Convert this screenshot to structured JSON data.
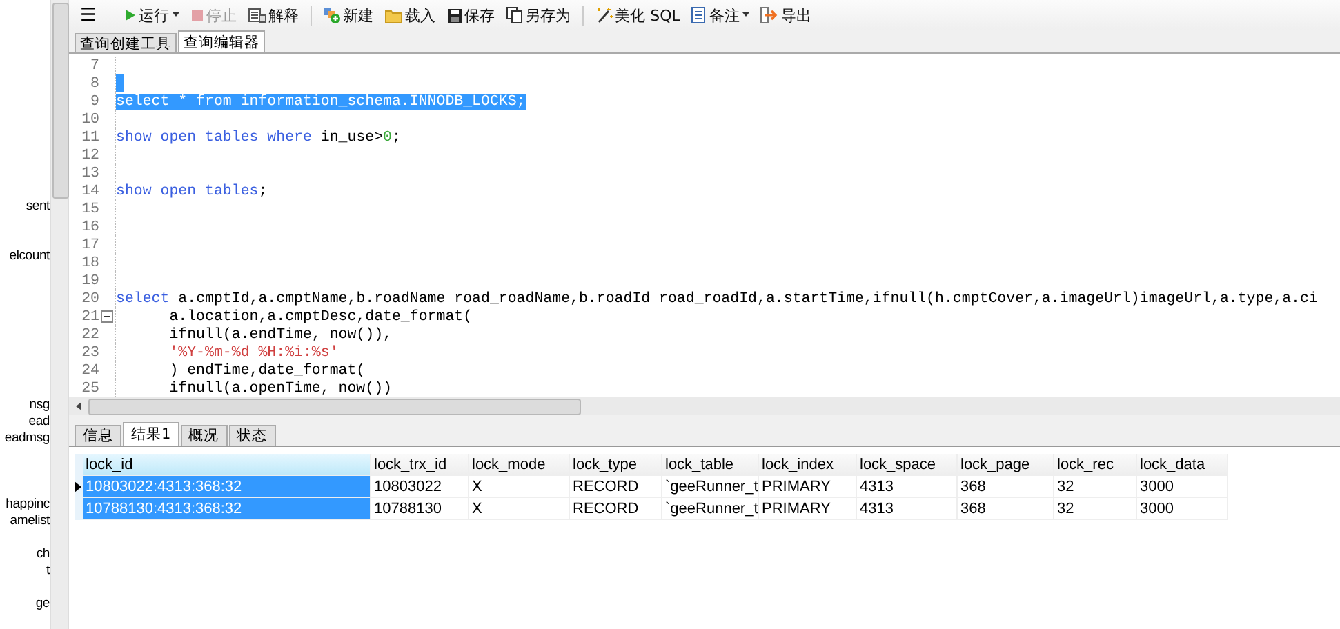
{
  "sidebar": {
    "items": [
      {
        "text": "sent"
      },
      {
        "text": "elcount"
      },
      {
        "text": "nsg"
      },
      {
        "text": "ead"
      },
      {
        "text": "eadmsg"
      },
      {
        "text": "happinc"
      },
      {
        "text": "amelist"
      },
      {
        "text": "ch"
      },
      {
        "text": "t"
      },
      {
        "text": "ge"
      }
    ]
  },
  "toolbar": {
    "menu": "☰",
    "items": [
      {
        "label": "运行",
        "kind": "run",
        "disabled": false,
        "dropdown": true
      },
      {
        "label": "停止",
        "kind": "stop",
        "disabled": true,
        "dropdown": false
      },
      {
        "label": "解释",
        "kind": "explain",
        "disabled": false,
        "dropdown": false
      },
      {
        "label": "新建",
        "kind": "new",
        "disabled": false,
        "dropdown": false
      },
      {
        "label": "载入",
        "kind": "load",
        "disabled": false,
        "dropdown": false
      },
      {
        "label": "保存",
        "kind": "save",
        "disabled": false,
        "dropdown": false
      },
      {
        "label": "另存为",
        "kind": "saveas",
        "disabled": false,
        "dropdown": false
      },
      {
        "label": "美化 SQL",
        "kind": "beautify",
        "disabled": false,
        "dropdown": false
      },
      {
        "label": "备注",
        "kind": "note",
        "disabled": false,
        "dropdown": true
      },
      {
        "label": "导出",
        "kind": "export",
        "disabled": false,
        "dropdown": false
      }
    ]
  },
  "editor_tabs": [
    {
      "label": "查询创建工具",
      "selected": false
    },
    {
      "label": "查询编辑器",
      "selected": true
    }
  ],
  "editor": {
    "lines": [
      {
        "num": "7"
      },
      {
        "num": "8",
        "selected": true
      },
      {
        "num": "9",
        "selected": true,
        "tokens": [
          {
            "text": "select * from information_schema.INNODB_LOCKS;",
            "kind": "kw"
          }
        ]
      },
      {
        "num": "10"
      },
      {
        "num": "11",
        "selected": false,
        "tokens": [
          {
            "text": "show open tables where",
            "kind": "kw"
          },
          {
            "text": " in_use>",
            "kind": "plain"
          },
          {
            "text": "0",
            "kind": "num"
          },
          {
            "text": ";",
            "kind": "plain"
          }
        ]
      },
      {
        "num": "12"
      },
      {
        "num": "13"
      },
      {
        "num": "14",
        "selected": false,
        "tokens": [
          {
            "text": "show open tables",
            "kind": "kw"
          },
          {
            "text": ";",
            "kind": "plain"
          }
        ]
      },
      {
        "num": "15"
      },
      {
        "num": "16"
      },
      {
        "num": "17"
      },
      {
        "num": "18"
      },
      {
        "num": "19"
      },
      {
        "num": "20",
        "selected": false,
        "tokens": [
          {
            "text": "select",
            "kind": "kw"
          },
          {
            "text": " a.cmptId,a.cmptName,b.roadName road_roadName,b.roadId road_roadId,a.startTime,ifnull(h.cmptCover,a.imageUrl)imageUrl,a.type,a.ci",
            "kind": "plain"
          }
        ]
      },
      {
        "num": "21",
        "selected": false,
        "fold": true,
        "tokens": [
          {
            "text": "      a.location,a.cmptDesc,date_format(",
            "kind": "plain"
          }
        ]
      },
      {
        "num": "22",
        "selected": false,
        "tokens": [
          {
            "text": "      ifnull(a.endTime, now()),",
            "kind": "plain"
          }
        ]
      },
      {
        "num": "23",
        "selected": false,
        "tokens": [
          {
            "text": "      '%Y-%m-%d %H:%i:%s'",
            "kind": "str"
          }
        ]
      },
      {
        "num": "24",
        "selected": false,
        "tokens": [
          {
            "text": "      ) endTime,date_format(",
            "kind": "plain"
          }
        ]
      },
      {
        "num": "25",
        "selected": false,
        "tokens": [
          {
            "text": "      ifnull(a.openTime, now())",
            "kind": "plain"
          }
        ]
      }
    ]
  },
  "result_tabs": [
    {
      "label": "信息",
      "selected": false
    },
    {
      "label": "结果1",
      "selected": true
    },
    {
      "label": "概况",
      "selected": false
    },
    {
      "label": "状态",
      "selected": false
    }
  ],
  "table": {
    "columns": [
      "lock_id",
      "lock_trx_id",
      "lock_mode",
      "lock_type",
      "lock_table",
      "lock_index",
      "lock_space",
      "lock_page",
      "lock_rec",
      "lock_data"
    ],
    "rows": [
      {
        "current": true,
        "selected": true,
        "cells": [
          "10803022:4313:368:32",
          "10803022",
          "X",
          "RECORD",
          "`geeRunner_t",
          "PRIMARY",
          "4313",
          "368",
          "32",
          "3000"
        ]
      },
      {
        "current": false,
        "selected": true,
        "cells": [
          "10788130:4313:368:32",
          "10788130",
          "X",
          "RECORD",
          "`geeRunner_t",
          "PRIMARY",
          "4313",
          "368",
          "32",
          "3000"
        ]
      }
    ]
  }
}
